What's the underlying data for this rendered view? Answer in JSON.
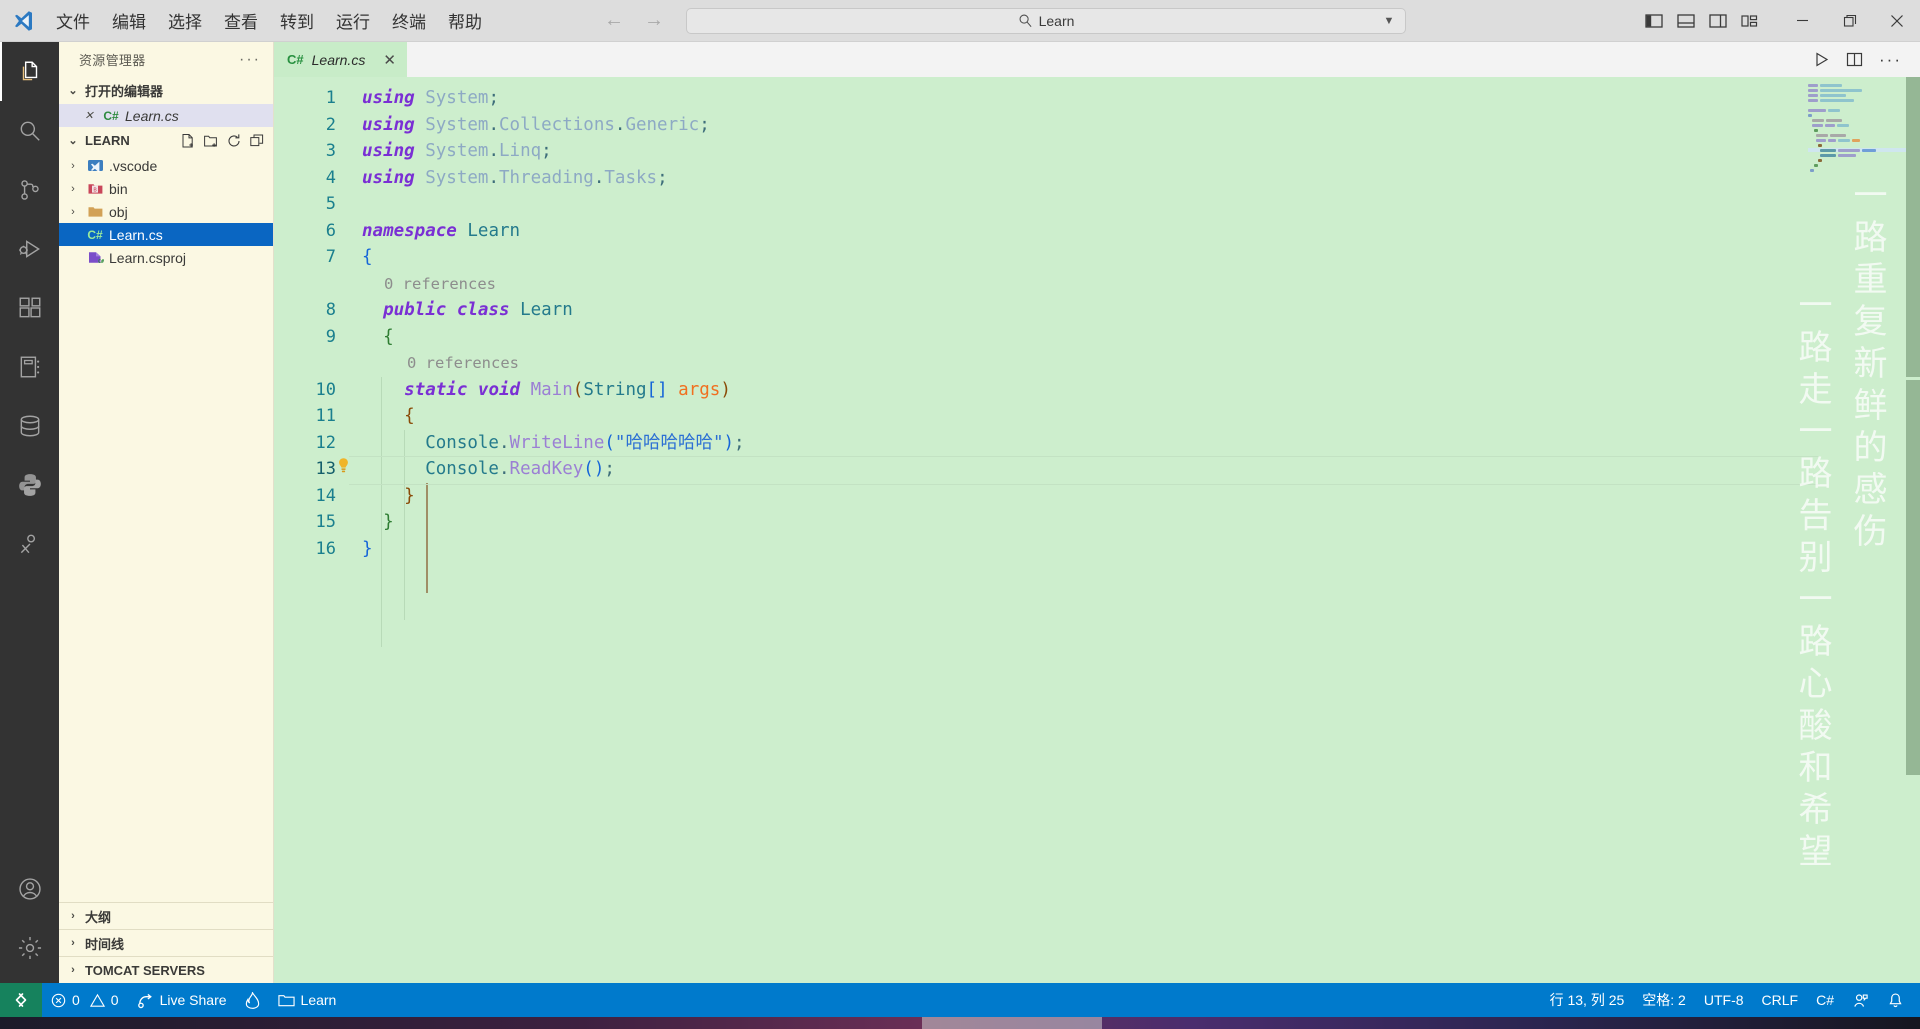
{
  "titlebar": {
    "app_icon": "vscode-logo-icon",
    "menu": [
      {
        "label": "文件",
        "name": "menu-file"
      },
      {
        "label": "编辑",
        "name": "menu-edit"
      },
      {
        "label": "选择",
        "name": "menu-selection"
      },
      {
        "label": "查看",
        "name": "menu-view"
      },
      {
        "label": "转到",
        "name": "menu-go"
      },
      {
        "label": "运行",
        "name": "menu-run"
      },
      {
        "label": "终端",
        "name": "menu-terminal"
      },
      {
        "label": "帮助",
        "name": "menu-help"
      }
    ],
    "nav_back": "←",
    "nav_forward": "→",
    "search": {
      "value": "Learn",
      "placeholder": "Learn",
      "icon": "search-icon",
      "chevron": "▼"
    },
    "layout_icons": [
      "toggle-primary-sidebar-icon",
      "toggle-panel-icon",
      "toggle-secondary-sidebar-icon",
      "customize-layout-icon"
    ],
    "window_controls": {
      "minimize": "−",
      "maximize": "▢",
      "close": "✕"
    }
  },
  "activitybar": {
    "items": [
      {
        "name": "activity-explorer",
        "icon": "files-icon",
        "active": true
      },
      {
        "name": "activity-search",
        "icon": "search-icon",
        "active": false
      },
      {
        "name": "activity-source-control",
        "icon": "source-control-icon",
        "active": false
      },
      {
        "name": "activity-run-debug",
        "icon": "run-debug-icon",
        "active": false
      },
      {
        "name": "activity-extensions",
        "icon": "extensions-icon",
        "active": false
      },
      {
        "name": "activity-notebook",
        "icon": "notebook-icon",
        "active": false
      },
      {
        "name": "activity-database",
        "icon": "database-icon",
        "active": false
      },
      {
        "name": "activity-python",
        "icon": "python-icon",
        "active": false
      },
      {
        "name": "activity-testing",
        "icon": "testing-icon",
        "active": false
      }
    ],
    "bottom": [
      {
        "name": "activity-accounts",
        "icon": "account-icon"
      },
      {
        "name": "activity-settings",
        "icon": "gear-icon"
      }
    ]
  },
  "sidebar": {
    "title": "资源管理器",
    "more_actions": "···",
    "open_editors": {
      "label": "打开的编辑器",
      "chevron": "⌄",
      "items": [
        {
          "name": "open-editor-learn-cs",
          "close": "✕",
          "badge": "C#",
          "label": "Learn.cs"
        }
      ]
    },
    "workspace": {
      "label": "LEARN",
      "chevron": "⌄",
      "actions": [
        "new-file-icon",
        "new-folder-icon",
        "refresh-icon",
        "collapse-all-icon"
      ],
      "items": [
        {
          "name": "folder-vscode",
          "chevron": "›",
          "icon": "vscode-folder-icon",
          "label": ".vscode",
          "selected": false
        },
        {
          "name": "folder-bin",
          "chevron": "›",
          "icon": "bin-folder-icon",
          "label": "bin",
          "selected": false
        },
        {
          "name": "folder-obj",
          "chevron": "›",
          "icon": "obj-folder-icon",
          "label": "obj",
          "selected": false
        },
        {
          "name": "file-learn-cs",
          "chevron": "",
          "icon": "csharp-file-icon",
          "label": "Learn.cs",
          "selected": true
        },
        {
          "name": "file-learn-csproj",
          "chevron": "",
          "icon": "csproj-file-icon",
          "label": "Learn.csproj",
          "selected": false
        }
      ]
    },
    "bottom_sections": [
      {
        "name": "section-outline",
        "chevron": "›",
        "label": "大纲"
      },
      {
        "name": "section-timeline",
        "chevron": "›",
        "label": "时间线"
      },
      {
        "name": "section-tomcat-servers",
        "chevron": "›",
        "label": "TOMCAT SERVERS"
      }
    ]
  },
  "editor": {
    "tab": {
      "badge": "C#",
      "label": "Learn.cs",
      "close": "✕"
    },
    "tab_actions": [
      "run-icon",
      "split-editor-icon",
      "more-actions-icon"
    ],
    "lines": [
      {
        "num": "1",
        "text": "using System;"
      },
      {
        "num": "2",
        "text": "using System.Collections.Generic;"
      },
      {
        "num": "3",
        "text": "using System.Linq;"
      },
      {
        "num": "4",
        "text": "using System.Threading.Tasks;"
      },
      {
        "num": "5",
        "text": ""
      },
      {
        "num": "6",
        "text": "namespace Learn"
      },
      {
        "num": "7",
        "text": "{"
      },
      {
        "num": "8",
        "text": "    public class Learn",
        "codelens": "0 references"
      },
      {
        "num": "9",
        "text": "    {"
      },
      {
        "num": "10",
        "text": "        static void Main(String[] args)",
        "codelens": "0 references"
      },
      {
        "num": "11",
        "text": "        {"
      },
      {
        "num": "12",
        "text": "            Console.WriteLine(\"哈哈哈哈哈\");"
      },
      {
        "num": "13",
        "text": "            Console.ReadKey();",
        "current": true,
        "glyph": "lightbulb-icon"
      },
      {
        "num": "14",
        "text": "        }"
      },
      {
        "num": "15",
        "text": "    }"
      },
      {
        "num": "16",
        "text": "}"
      }
    ],
    "watermark": {
      "column_1": "一路走一路告别一路心酸和希望",
      "column_2": "一路重复新鲜的感伤"
    }
  },
  "statusbar": {
    "remote_icon": "remote-window-icon",
    "left": [
      {
        "name": "status-problems",
        "icon": "error-icon",
        "label": "0",
        "icon2": "warning-icon",
        "label2": "0"
      },
      {
        "name": "status-live-share",
        "icon": "live-share-icon",
        "label": "Live Share"
      },
      {
        "name": "status-flame",
        "icon": "flame-icon",
        "label": ""
      },
      {
        "name": "status-folder",
        "icon": "folder-icon",
        "label": "Learn"
      }
    ],
    "right": [
      {
        "name": "status-cursor-position",
        "label": "行 13, 列 25"
      },
      {
        "name": "status-indentation",
        "label": "空格: 2"
      },
      {
        "name": "status-encoding",
        "label": "UTF-8"
      },
      {
        "name": "status-eol",
        "label": "CRLF"
      },
      {
        "name": "status-language-mode",
        "label": "C#"
      },
      {
        "name": "status-feedback",
        "icon": "feedback-icon",
        "label": ""
      },
      {
        "name": "status-notifications",
        "icon": "bell-icon",
        "label": ""
      }
    ]
  },
  "colors": {
    "accent": "#007acc",
    "remote": "#16825d",
    "editor_bg": "#cdeecd",
    "sidebar_bg": "#fbf8e3",
    "selection": "#0a66c2",
    "activitybar_bg": "#333333"
  }
}
